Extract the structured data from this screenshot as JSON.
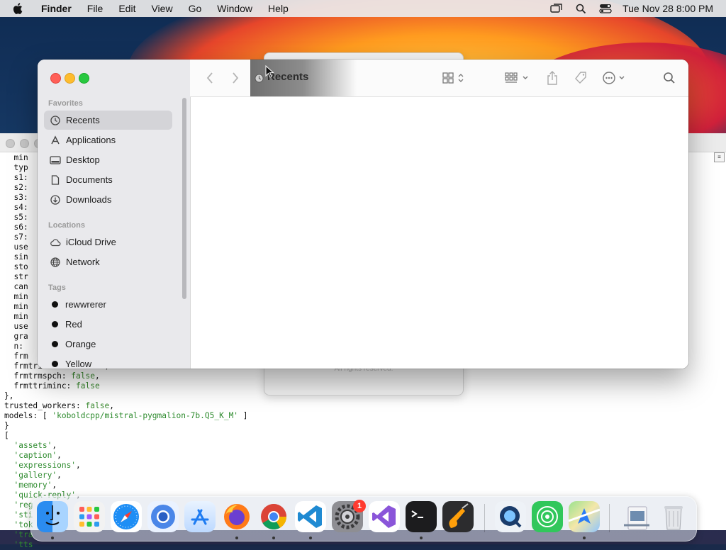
{
  "menubar": {
    "app_name": "Finder",
    "items": [
      "File",
      "Edit",
      "View",
      "Go",
      "Window",
      "Help"
    ],
    "clock": "Tue Nov 28  8:00 PM"
  },
  "terminal": {
    "lines": [
      "  min",
      "  typ",
      "  s1:",
      "  s2:",
      "  s3:",
      "  s4:",
      "  s5:",
      "  s6:",
      "  s7:",
      "  use",
      "  sin",
      "  sto",
      "  str",
      "  can",
      "  min",
      "  min",
      "  min",
      "  use",
      "  gra",
      "  n: ",
      "  frm",
      "  frmtrimbilin: false,",
      "  frmtrmspch: false,",
      "  frmttriminc: false",
      "},",
      "trusted_workers: false,",
      "models: [ 'koboldcpp/mistral-pygmalion-7b.Q5_K_M' ]",
      "}",
      "[",
      "  'assets',",
      "  'caption',",
      "  'expressions',",
      "  'gallery',",
      "  'memory',",
      "  'quick-reply',",
      "  'reg",
      "  'sti",
      "  'tok",
      "  'tra",
      "  'tts"
    ]
  },
  "ghost_dialog": {
    "text": "All rights reserved."
  },
  "finder": {
    "title": "Recents",
    "sidebar": {
      "favorites_heading": "Favorites",
      "favorites": [
        {
          "label": "Recents",
          "icon": "clock-icon",
          "selected": true
        },
        {
          "label": "Applications",
          "icon": "applications-icon"
        },
        {
          "label": "Desktop",
          "icon": "desktop-icon"
        },
        {
          "label": "Documents",
          "icon": "document-icon"
        },
        {
          "label": "Downloads",
          "icon": "download-icon"
        }
      ],
      "locations_heading": "Locations",
      "locations": [
        {
          "label": "iCloud Drive",
          "icon": "cloud-icon"
        },
        {
          "label": "Network",
          "icon": "globe-icon"
        }
      ],
      "tags_heading": "Tags",
      "tags": [
        {
          "label": "rewwrerer",
          "color": "#111111"
        },
        {
          "label": "Red",
          "color": "#111111"
        },
        {
          "label": "Orange",
          "color": "#111111"
        },
        {
          "label": "Yellow",
          "color": "#111111"
        }
      ]
    }
  },
  "dock": {
    "apps": [
      "finder-icon",
      "launchpad-icon",
      "safari-icon",
      "chromium-icon",
      "app-store-icon",
      "firefox-icon",
      "chrome-icon",
      "vscode-icon",
      "system-settings-icon",
      "visual-studio-icon",
      "terminal-icon",
      "garageband-icon",
      "quicktime-icon",
      "find-my-icon",
      "maps-icon",
      "preview-icon",
      "trash-icon"
    ],
    "settings_badge": "1"
  }
}
